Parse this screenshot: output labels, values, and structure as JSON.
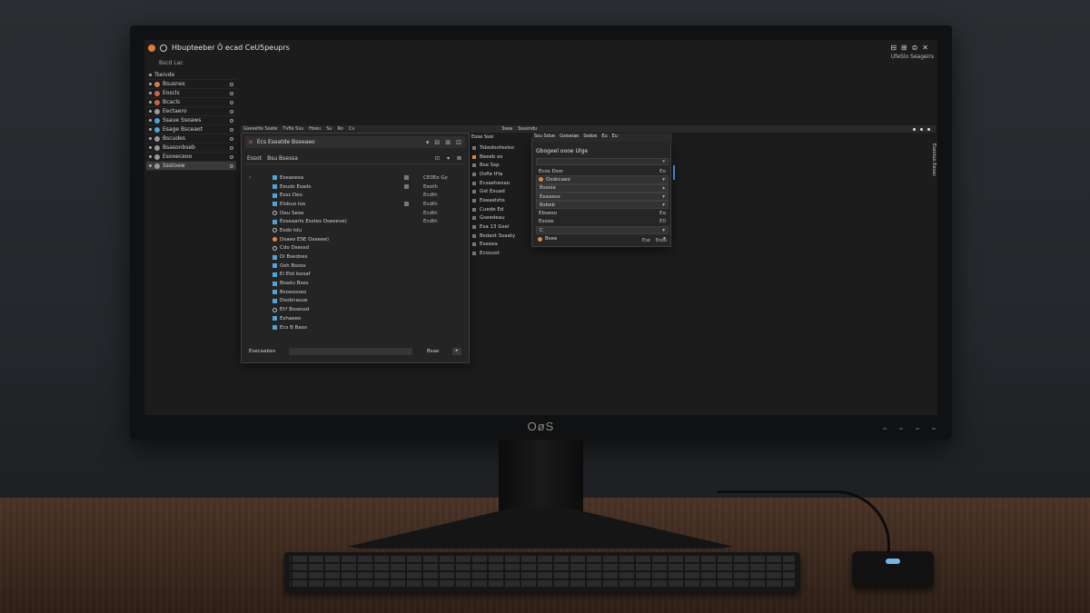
{
  "monitor": {
    "brand": "OøS"
  },
  "window": {
    "title": "Hbupteeber Ö ecad CeU5peuprs",
    "controls": [
      "⊟",
      "⊞",
      "⊜",
      "✕"
    ],
    "subtitle": "UfeSlo Seageirs"
  },
  "sidebar": {
    "header": "Bscd Lac",
    "items": [
      {
        "label": "Tseivde",
        "icon": "bullet-icon"
      },
      {
        "label": "Bsusnes",
        "icon": "orange-dot-icon"
      },
      {
        "label": "Eoscls",
        "icon": "red-dot-icon"
      },
      {
        "label": "Bcacls",
        "icon": "red-dot-icon"
      },
      {
        "label": "Eectaero",
        "icon": "gray-dot-icon"
      },
      {
        "label": "Ssaue Ssoaws",
        "icon": "blue-dot-icon"
      },
      {
        "label": "Esage Bsceaot",
        "icon": "blue-dot-icon"
      },
      {
        "label": "Bscudes",
        "icon": "gray-dot-icon"
      },
      {
        "label": "Bsasonbseb",
        "icon": "gray-dot-icon"
      },
      {
        "label": "Esooeceoo",
        "icon": "gray-dot-icon"
      },
      {
        "label": "Ssstoew",
        "icon": "gray-dot-icon"
      }
    ]
  },
  "toolbar": {
    "items": [
      "Gxeselte Ssate",
      "Tvfle Ssu",
      "Hoeu",
      "Su",
      "Ro",
      "Cv"
    ],
    "after_dialog": [
      "Ssea",
      "Ssusndu"
    ]
  },
  "dialog": {
    "title": "Ecs Eseatde Bseeaeo",
    "tools": [
      "▾",
      "⊟",
      "⊞",
      "⊡"
    ],
    "path": [
      "Essot",
      "Bsu Bsessa"
    ],
    "path_tools": [
      "⊡",
      "▾",
      "⊠"
    ],
    "back": "‹",
    "files": [
      {
        "name": "Eseaoesa",
        "type": "folder",
        "size": "CE0Ee Gy",
        "checked": true
      },
      {
        "name": "Eeuds Esads",
        "type": "folder",
        "size": "Eeoth",
        "checked": true
      },
      {
        "name": "Esss Deo",
        "type": "folder",
        "size": "Ecdth",
        "checked": false
      },
      {
        "name": "Elsbuo loo",
        "type": "folder",
        "size": "Ecdth",
        "checked": true
      },
      {
        "name": "Oeu Seoe",
        "type": "file",
        "size": "Ecdth",
        "checked": false
      },
      {
        "name": "Esseaarts  Esstes Oseeeve)",
        "type": "folder",
        "size": "Ecdth",
        "checked": false
      },
      {
        "name": "Esdo tdu",
        "type": "file",
        "size": "",
        "checked": false
      },
      {
        "name": "Dsaeo     ESE Oseeee)",
        "type": "image",
        "size": "",
        "checked": false
      },
      {
        "name": "Cdo Dsessd",
        "type": "file",
        "size": "",
        "checked": false
      },
      {
        "name": "Di Bsedoes",
        "type": "folder",
        "size": "",
        "checked": false
      },
      {
        "name": "Osh Bsoos",
        "type": "folder",
        "size": "",
        "checked": false
      },
      {
        "name": "Ei Etd lsosaf",
        "type": "folder",
        "size": "",
        "checked": false
      },
      {
        "name": "Bsadu Bses",
        "type": "folder",
        "size": "",
        "checked": false
      },
      {
        "name": "Bsoessoeo",
        "type": "folder",
        "size": "",
        "checked": false
      },
      {
        "name": "Dsobnasue",
        "type": "folder",
        "size": "",
        "checked": false
      },
      {
        "name": "Et? Bssessd",
        "type": "file",
        "size": "",
        "checked": false
      },
      {
        "name": "Eshaeeo",
        "type": "folder",
        "size": "",
        "checked": false
      },
      {
        "name": "Ecs B Baos",
        "type": "folder",
        "size": "",
        "checked": false
      }
    ],
    "more": "• • •",
    "footer": {
      "label": "Esecaabes",
      "button": "Bsae",
      "arrow": "▸"
    }
  },
  "middle": {
    "header": "Eooe  Ssoi",
    "items": [
      {
        "label": "Tsbsdoofeelss",
        "marker": "gray"
      },
      {
        "label": "Beeeb es",
        "marker": "orange"
      },
      {
        "label": "Bse Ssp",
        "marker": "gray"
      },
      {
        "label": "Dsfle tHa",
        "marker": "gray"
      },
      {
        "label": "Ecsaeheoao",
        "marker": "gray"
      },
      {
        "label": "Gst Esuad",
        "marker": "gray"
      },
      {
        "label": "Eeeaelshs",
        "marker": "gray"
      },
      {
        "label": "Cuede Ed",
        "marker": "gray"
      },
      {
        "label": "Gseedeau",
        "marker": "gray"
      },
      {
        "label": "Esa 13 Gsei",
        "marker": "gray"
      },
      {
        "label": "Bsdaot Ssaaty",
        "marker": "gray"
      },
      {
        "label": "Eseoea",
        "marker": "gray"
      },
      {
        "label": "Ecouost",
        "marker": "gray"
      }
    ]
  },
  "settings": {
    "tabs": [
      "Ssu Sdue",
      "Gsiseiae",
      "Ssdoe",
      "Eu",
      "Eu"
    ],
    "title": "Gbogeel oooe  Ulge",
    "dropdown_arrow": "▾",
    "rows": [
      {
        "label": "Ecos Dsor",
        "value": "Eo",
        "style": "plain",
        "icon": ""
      },
      {
        "label": "Ossbcaeo",
        "value": "▾",
        "style": "field",
        "icon": "orange-dot-icon"
      },
      {
        "label": "Bsosia",
        "value": "▴",
        "style": "field",
        "icon": ""
      },
      {
        "label": "Eeaaess",
        "value": "▾",
        "style": "field",
        "icon": ""
      },
      {
        "label": "Bsbeb",
        "value": "▾",
        "style": "field",
        "icon": ""
      },
      {
        "label": "Ebseoo",
        "value": "Ea",
        "style": "plain",
        "icon": ""
      },
      {
        "label": "Esooe",
        "value": "E0",
        "style": "plain",
        "icon": ""
      },
      {
        "label": "C",
        "value": "▾",
        "style": "field",
        "icon": ""
      },
      {
        "label": "Bsee",
        "value": "▾",
        "style": "plain",
        "icon": "orange-dot-icon"
      }
    ],
    "footer": [
      "Ese",
      "Esdu"
    ]
  },
  "right_rail": "Esestuo Eeusc"
}
